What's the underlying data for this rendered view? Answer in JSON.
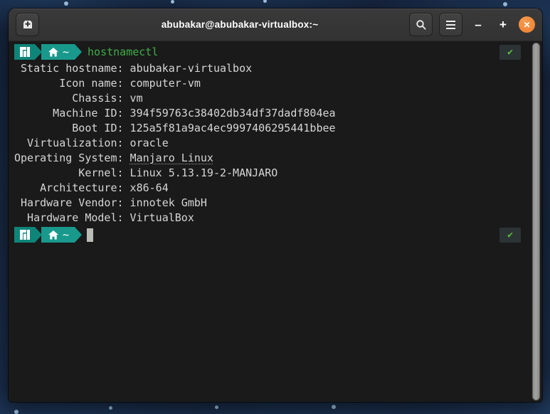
{
  "window": {
    "title": "abubakar@abubakar-virtualbox:~",
    "titlebar": {
      "minimize_label": "–",
      "maximize_label": "+",
      "close_label": "✕"
    },
    "icons": {
      "new_tab": "tab-new-icon",
      "search": "search-icon",
      "menu": "hamburger-menu-icon",
      "close": "close-icon",
      "prompt_logo": "manjaro-logo-icon",
      "prompt_home": "home-icon",
      "status_ok": "checkmark-icon"
    }
  },
  "terminal": {
    "prompt_path": "~",
    "command": "hostnamectl",
    "status_ok": "✔",
    "output_lines": [
      {
        "text": " Static hostname: abubakar-virtualbox"
      },
      {
        "text": "       Icon name: computer-vm"
      },
      {
        "text": "         Chassis: vm"
      },
      {
        "text": "      Machine ID: 394f59763c38402db34df37dadf804ea"
      },
      {
        "text": "         Boot ID: 125a5f81a9ac4ec9997406295441bbee"
      },
      {
        "text": "  Virtualization: oracle"
      },
      {
        "text": "Operating System: ",
        "link": "Manjaro Linux"
      },
      {
        "text": "          Kernel: Linux 5.13.19-2-MANJARO"
      },
      {
        "text": "    Architecture: x86-64"
      },
      {
        "text": " Hardware Vendor: innotek GmbH"
      },
      {
        "text": "  Hardware Model: VirtualBox"
      }
    ]
  },
  "colors": {
    "accent_teal": "#18998c",
    "accent_teal_dark": "#0f8579",
    "command_green": "#3fae46",
    "check_green": "#5dbd3b",
    "close_orange": "#ee7f2e",
    "terminal_bg": "#1a1a1a",
    "titlebar_bg": "#343434",
    "desktop_navy": "#16263f"
  }
}
